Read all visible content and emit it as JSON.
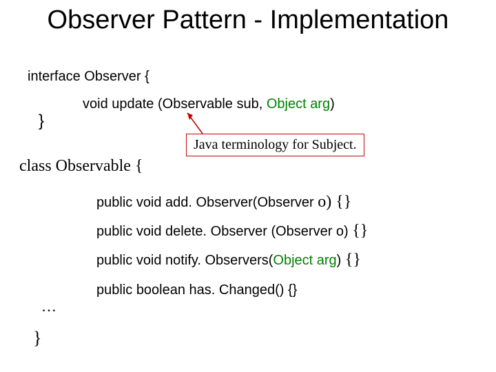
{
  "title": "Observer Pattern - Implementation",
  "interface_decl": "interface Observer {",
  "update": {
    "prefix": "void update (Observable sub, ",
    "arg": "Object arg",
    "suffix": ")"
  },
  "close1": "}",
  "callout": "Java terminology for Subject.",
  "class_decl": "class Observable {",
  "methods": {
    "add": {
      "prefix": "public void add. Observer(Observer ",
      "o": "o",
      "suffix": ") {}"
    },
    "delete": {
      "text": "public void delete. Observer (Observer o) ",
      "braces": " {}"
    },
    "notify": {
      "prefix": "public void notify. Observers(",
      "arg": "Object arg",
      "mid": ") ",
      "braces": "{}"
    },
    "hasChanged": "public boolean has. Changed() {}"
  },
  "ellipsis": "…",
  "close2": "}"
}
